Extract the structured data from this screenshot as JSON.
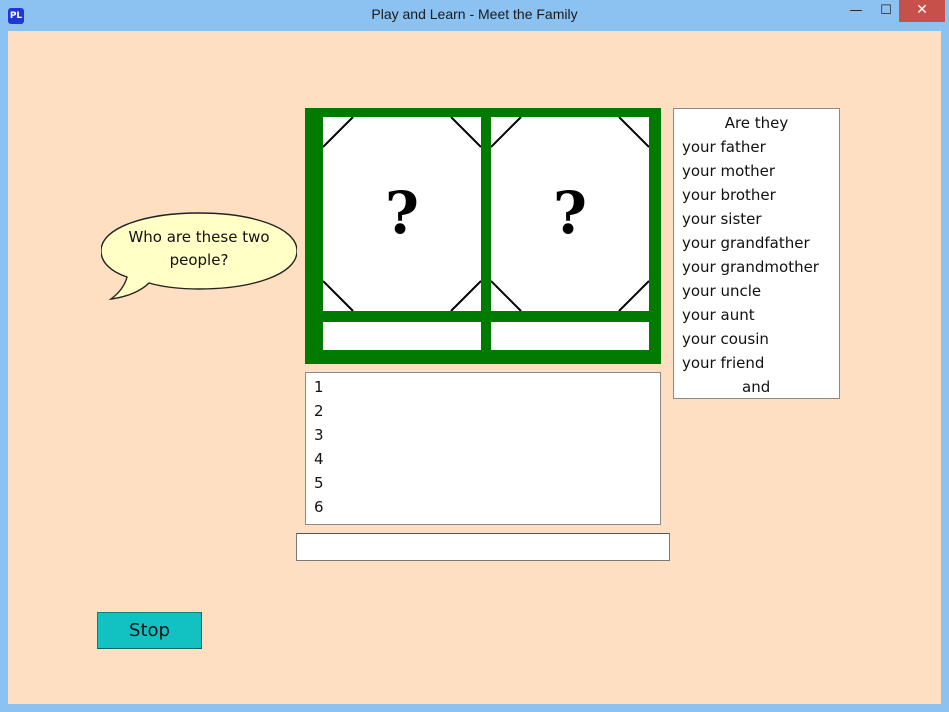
{
  "window": {
    "icon_text": "PL",
    "title": "Play and Learn - Meet the Family",
    "minimize": "—",
    "maximize": "☐",
    "close": "✕"
  },
  "bubble": {
    "text": "Who are these two people?"
  },
  "pictures": [
    {
      "symbol": "?"
    },
    {
      "symbol": "?"
    }
  ],
  "word_list": {
    "heading": "Are they",
    "items": [
      "your father",
      "your mother",
      "your brother",
      "your sister",
      "your grandfather",
      "your grandmother",
      "your uncle",
      "your aunt",
      "your cousin",
      "your friend"
    ],
    "tail": "and"
  },
  "answers": [
    "1",
    "2",
    "3",
    "4",
    "5",
    "6"
  ],
  "input": {
    "value": ""
  },
  "stop_button": {
    "label": "Stop"
  },
  "colors": {
    "background": "#ffdfc2",
    "frame": "#007a00",
    "bubble": "#ffffc6",
    "button": "#12c2c2",
    "titlebar": "#8cc2f2",
    "close": "#c7504b"
  }
}
